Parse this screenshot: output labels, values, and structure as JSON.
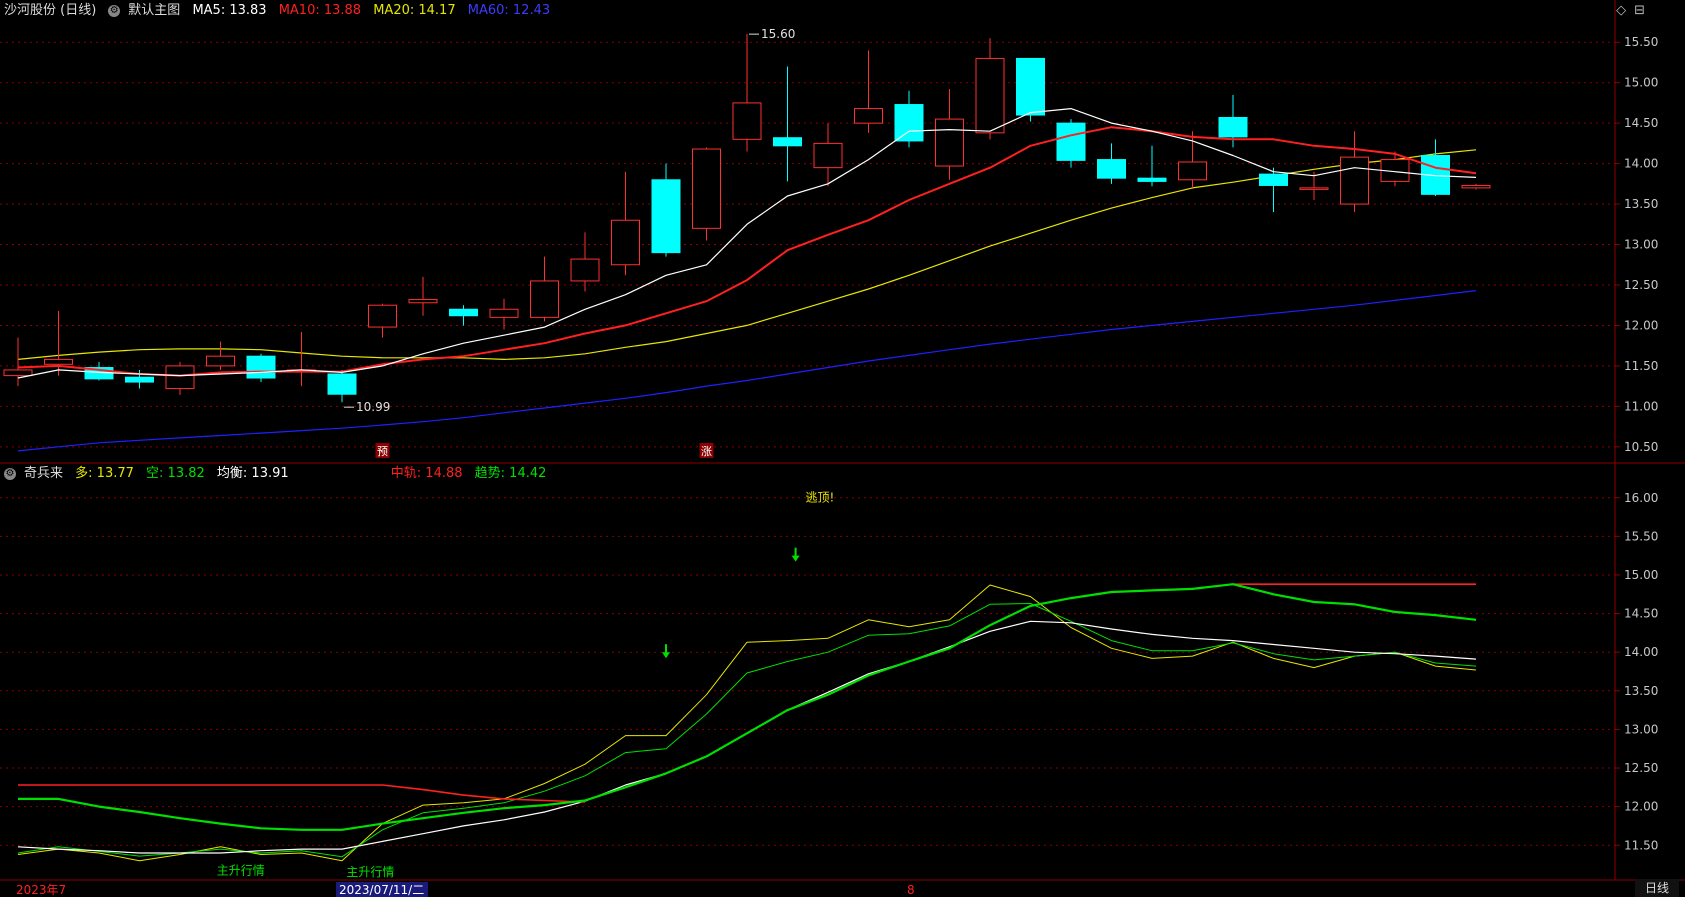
{
  "header_main": {
    "stock_name": "沙河股份 (日线)",
    "template": "默认主图",
    "ma5": "MA5: 13.83",
    "ma10": "MA10: 13.88",
    "ma20": "MA20: 14.17",
    "ma60": "MA60: 12.43"
  },
  "header_sub": {
    "indicator": "奇兵来",
    "duo": "多: 13.77",
    "kong": "空: 13.82",
    "junheng": "均衡: 13.91",
    "zhonggui": "中轨: 14.88",
    "qushi": "趋势: 14.42"
  },
  "top_icons": {
    "diamond": "◇",
    "expand": "⊟"
  },
  "period_tab": "日线",
  "colors": {
    "up": "#ff3030",
    "down": "#00ffff",
    "ma5": "#ffffff",
    "ma10": "#ff2020",
    "ma20": "#e6e600",
    "ma60": "#2020ff",
    "grid": "#8b0000",
    "axis_text": "#c8c8c8",
    "green": "#00e000",
    "yellow": "#e6e600"
  },
  "chart_data": [
    {
      "type": "candlestick",
      "name": "main",
      "ylim": [
        10.3,
        15.75
      ],
      "y_ticks": [
        "10.50",
        "11.00",
        "11.50",
        "12.00",
        "12.50",
        "13.00",
        "13.50",
        "14.00",
        "14.50",
        "15.00",
        "15.50"
      ],
      "ohlc": [
        [
          11.38,
          11.85,
          11.25,
          11.45
        ],
        [
          11.52,
          12.18,
          11.38,
          11.58
        ],
        [
          11.48,
          11.55,
          11.32,
          11.34
        ],
        [
          11.36,
          11.45,
          11.22,
          11.3
        ],
        [
          11.22,
          11.55,
          11.14,
          11.5
        ],
        [
          11.5,
          11.8,
          11.45,
          11.62
        ],
        [
          11.62,
          11.65,
          11.3,
          11.35
        ],
        [
          11.43,
          11.92,
          11.25,
          11.45
        ],
        [
          11.4,
          11.45,
          11.05,
          11.15
        ],
        [
          11.98,
          12.27,
          11.85,
          12.25
        ],
        [
          12.28,
          12.6,
          12.12,
          12.32
        ],
        [
          12.2,
          12.25,
          12.0,
          12.12
        ],
        [
          12.1,
          12.33,
          11.95,
          12.2
        ],
        [
          12.1,
          12.85,
          12.05,
          12.55
        ],
        [
          12.55,
          13.15,
          12.42,
          12.82
        ],
        [
          12.75,
          13.9,
          12.62,
          13.3
        ],
        [
          13.8,
          14.0,
          12.85,
          12.9
        ],
        [
          13.2,
          14.2,
          13.05,
          14.18
        ],
        [
          14.3,
          15.6,
          14.15,
          14.75
        ],
        [
          14.32,
          15.2,
          13.78,
          14.22
        ],
        [
          13.95,
          14.5,
          13.72,
          14.25
        ],
        [
          14.5,
          15.4,
          14.38,
          14.68
        ],
        [
          14.73,
          14.9,
          14.2,
          14.28
        ],
        [
          13.97,
          14.92,
          13.8,
          14.55
        ],
        [
          14.38,
          15.55,
          14.3,
          15.3
        ],
        [
          15.3,
          15.3,
          14.52,
          14.6
        ],
        [
          14.5,
          14.55,
          13.95,
          14.04
        ],
        [
          14.05,
          14.25,
          13.75,
          13.82
        ],
        [
          13.82,
          14.22,
          13.72,
          13.78
        ],
        [
          13.8,
          14.4,
          13.7,
          14.02
        ],
        [
          14.57,
          14.85,
          14.2,
          14.33
        ],
        [
          13.87,
          13.95,
          13.4,
          13.73
        ],
        [
          13.7,
          13.9,
          13.55,
          13.7
        ],
        [
          13.5,
          14.4,
          13.4,
          14.08
        ],
        [
          13.78,
          14.15,
          13.72,
          14.05
        ],
        [
          14.1,
          14.3,
          13.6,
          13.62
        ],
        [
          13.7,
          13.75,
          13.68,
          13.73
        ]
      ],
      "ma5": [
        11.35,
        11.45,
        11.42,
        11.4,
        11.38,
        11.4,
        11.42,
        11.45,
        11.42,
        11.5,
        11.65,
        11.78,
        11.88,
        11.98,
        12.2,
        12.38,
        12.62,
        12.75,
        13.25,
        13.6,
        13.75,
        14.05,
        14.4,
        14.42,
        14.4,
        14.63,
        14.68,
        14.5,
        14.4,
        14.28,
        14.1,
        13.9,
        13.85,
        13.95,
        13.9,
        13.85,
        13.83
      ],
      "ma10": [
        11.48,
        11.5,
        11.45,
        11.4,
        11.38,
        11.42,
        11.43,
        11.43,
        11.43,
        11.52,
        11.58,
        11.62,
        11.7,
        11.78,
        11.9,
        12.0,
        12.15,
        12.3,
        12.56,
        12.93,
        13.12,
        13.3,
        13.55,
        13.75,
        13.95,
        14.22,
        14.35,
        14.45,
        14.4,
        14.33,
        14.3,
        14.3,
        14.22,
        14.18,
        14.12,
        13.95,
        13.88
      ],
      "ma20": [
        11.58,
        11.63,
        11.67,
        11.7,
        11.71,
        11.71,
        11.7,
        11.66,
        11.62,
        11.6,
        11.6,
        11.6,
        11.58,
        11.6,
        11.65,
        11.73,
        11.8,
        11.9,
        12.0,
        12.15,
        12.3,
        12.45,
        12.62,
        12.8,
        12.98,
        13.14,
        13.3,
        13.45,
        13.58,
        13.7,
        13.77,
        13.85,
        13.93,
        14.0,
        14.05,
        14.12,
        14.17
      ],
      "ma60": [
        10.45,
        10.5,
        10.55,
        10.58,
        10.61,
        10.64,
        10.67,
        10.7,
        10.73,
        10.77,
        10.81,
        10.86,
        10.92,
        10.98,
        11.04,
        11.1,
        11.17,
        11.25,
        11.32,
        11.4,
        11.48,
        11.56,
        11.63,
        11.7,
        11.77,
        11.83,
        11.89,
        11.95,
        12.0,
        12.05,
        12.1,
        12.15,
        12.2,
        12.25,
        12.31,
        12.37,
        12.43
      ],
      "annotations": [
        {
          "text": "15.60",
          "bar": 18,
          "price": 15.6
        },
        {
          "text": "10.99",
          "bar": 8,
          "price": 10.99
        }
      ],
      "signals": [
        {
          "text": "预",
          "bar": 9
        },
        {
          "text": "涨",
          "bar": 17
        }
      ]
    },
    {
      "type": "line",
      "name": "奇兵来",
      "ylim": [
        11.05,
        16.45
      ],
      "y_ticks": [
        "11.50",
        "12.00",
        "12.50",
        "13.00",
        "13.50",
        "14.00",
        "14.50",
        "15.00",
        "15.50",
        "16.00"
      ],
      "series": [
        {
          "name": "多",
          "values": [
            11.38,
            11.45,
            11.4,
            11.3,
            11.38,
            11.48,
            11.38,
            11.4,
            11.3,
            11.78,
            12.02,
            12.05,
            12.1,
            12.3,
            12.55,
            12.92,
            12.92,
            13.45,
            14.13,
            14.15,
            14.18,
            14.42,
            14.33,
            14.42,
            14.87,
            14.72,
            14.32,
            14.05,
            13.92,
            13.95,
            14.13,
            13.92,
            13.8,
            13.95,
            14.0,
            13.82,
            13.77
          ]
        },
        {
          "name": "空",
          "values": [
            11.4,
            11.48,
            11.42,
            11.36,
            11.4,
            11.45,
            11.4,
            11.43,
            11.35,
            11.7,
            11.92,
            11.98,
            12.05,
            12.2,
            12.4,
            12.7,
            12.75,
            13.2,
            13.73,
            13.88,
            14.0,
            14.22,
            14.24,
            14.34,
            14.62,
            14.63,
            14.4,
            14.15,
            14.02,
            14.02,
            14.12,
            13.98,
            13.9,
            13.95,
            14.0,
            13.86,
            13.82
          ]
        },
        {
          "name": "均衡",
          "values": [
            11.48,
            11.45,
            11.43,
            11.4,
            11.4,
            11.4,
            11.43,
            11.45,
            11.45,
            11.55,
            11.65,
            11.75,
            11.83,
            11.93,
            12.07,
            12.28,
            12.43,
            12.65,
            12.95,
            13.25,
            13.48,
            13.72,
            13.88,
            14.07,
            14.27,
            14.4,
            14.38,
            14.3,
            14.23,
            14.18,
            14.15,
            14.1,
            14.05,
            14.0,
            13.98,
            13.95,
            13.91
          ]
        },
        {
          "name": "中轨",
          "values": [
            12.28,
            12.28,
            12.28,
            12.28,
            12.28,
            12.28,
            12.28,
            12.28,
            12.28,
            12.28,
            12.22,
            12.15,
            12.1,
            12.08,
            12.06,
            null,
            null,
            null,
            null,
            null,
            null,
            null,
            null,
            null,
            null,
            null,
            null,
            null,
            null,
            null,
            14.88,
            14.88,
            14.88,
            14.88,
            14.88,
            14.88,
            14.88
          ]
        },
        {
          "name": "趋势",
          "values": [
            12.1,
            12.1,
            12.0,
            11.93,
            11.85,
            11.78,
            11.72,
            11.7,
            11.7,
            11.78,
            11.85,
            11.92,
            11.98,
            12.02,
            12.08,
            12.25,
            12.43,
            12.65,
            12.95,
            13.25,
            13.45,
            13.7,
            13.88,
            14.05,
            14.35,
            14.6,
            14.7,
            14.78,
            14.8,
            14.82,
            14.88,
            14.75,
            14.65,
            14.62,
            14.52,
            14.48,
            14.42
          ]
        }
      ],
      "labels": [
        {
          "text": "逃顶!",
          "bar": 19.8,
          "value": 15.95
        },
        {
          "text": "主升行情",
          "bar": 5.5,
          "value": 11.12
        },
        {
          "text": "主升行情",
          "bar": 8.7,
          "value": 11.1
        }
      ],
      "arrows": [
        {
          "bar": 16,
          "value": 14.0
        },
        {
          "bar": 19.2,
          "value": 15.25
        }
      ]
    }
  ],
  "x_axis": {
    "labels": [
      {
        "text": "2023年7",
        "bar": 0
      },
      {
        "text": "2023/07/11/二",
        "bar": 8
      },
      {
        "text": "8",
        "bar": 22
      }
    ]
  }
}
